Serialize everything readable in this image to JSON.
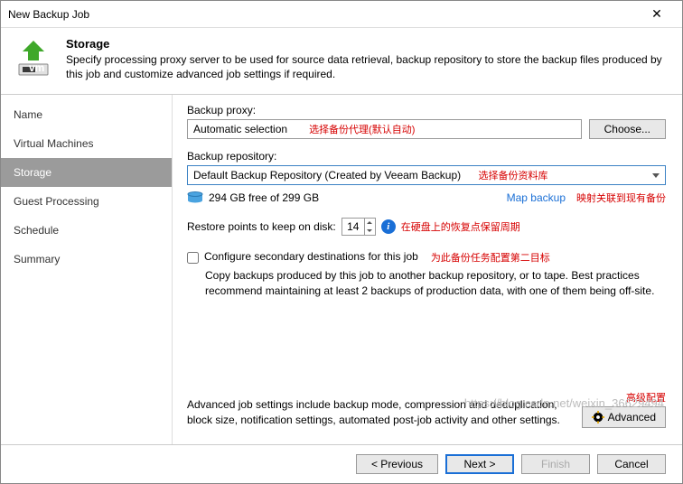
{
  "window": {
    "title": "New Backup Job"
  },
  "header": {
    "title": "Storage",
    "subtitle": "Specify processing proxy server to be used for source data retrieval, backup repository to store the backup files produced by this job and customize advanced job settings if required."
  },
  "sidebar": {
    "items": [
      {
        "label": "Name"
      },
      {
        "label": "Virtual Machines"
      },
      {
        "label": "Storage"
      },
      {
        "label": "Guest Processing"
      },
      {
        "label": "Schedule"
      },
      {
        "label": "Summary"
      }
    ],
    "selected_index": 2
  },
  "proxy": {
    "label": "Backup proxy:",
    "value": "Automatic selection",
    "note": "选择备份代理(默认自动)",
    "choose_label": "Choose..."
  },
  "repo": {
    "label": "Backup repository:",
    "value": "Default Backup Repository (Created by Veeam Backup)",
    "note": "选择备份资料库",
    "disk_free": "294 GB free of 299 GB",
    "map_backup": "Map backup",
    "map_note": "映射关联到现有备份"
  },
  "restore": {
    "label": "Restore points to keep on disk:",
    "value": "14",
    "note": "在硬盘上的恢复点保留周期"
  },
  "secondary": {
    "label": "Configure secondary destinations for this job",
    "note": "为此备份任务配置第二目标",
    "desc": "Copy backups produced by this job to another backup repository, or to tape. Best practices recommend maintaining at least 2 backups of production data, with one of them being off-site."
  },
  "advanced": {
    "text": "Advanced job settings include backup mode, compression and deduplication, block size, notification settings, automated post-job activity and other settings.",
    "note": "高级配置",
    "button_label": "Advanced"
  },
  "footer": {
    "previous": "< Previous",
    "next": "Next >",
    "finish": "Finish",
    "cancel": "Cancel"
  },
  "watermark": "https://blog.csdn.net/weixin_36629494"
}
